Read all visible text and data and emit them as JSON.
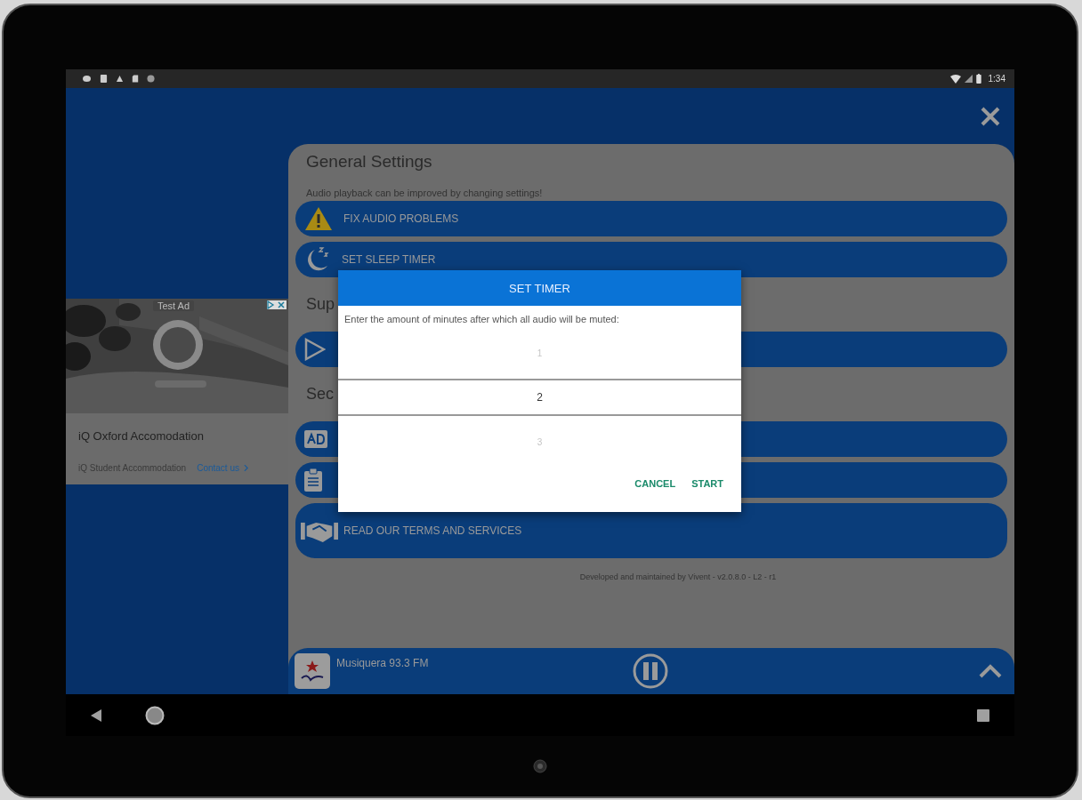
{
  "status_bar": {
    "time": "1:34"
  },
  "ad": {
    "badge": "Test Ad",
    "title": "iQ Oxford Accomodation",
    "advertiser": "iQ Student Accommodation",
    "link": "Contact us"
  },
  "settings": {
    "title": "General Settings",
    "subtitle": "Audio playback can be improved by changing settings!",
    "items": [
      {
        "kind": "button",
        "label": "FIX AUDIO PROBLEMS"
      },
      {
        "kind": "button",
        "label": "SET SLEEP TIMER"
      },
      {
        "kind": "heading",
        "label": "Sup"
      },
      {
        "kind": "button"
      },
      {
        "kind": "heading",
        "label": "Sec"
      },
      {
        "kind": "button"
      },
      {
        "kind": "button"
      },
      {
        "kind": "tall-button",
        "label": "READ OUR TERMS AND SERVICES"
      }
    ],
    "footer": "Developed and maintained by Vivent - v2.0.8.0 - L2 - r1"
  },
  "player": {
    "station": "Musiquera 93.3 FM",
    "playing": true
  },
  "dialog": {
    "title": "SET TIMER",
    "message": "Enter the amount of minutes after which all audio will be muted:",
    "picker": [
      {
        "value": "1",
        "selected": false
      },
      {
        "value": "2",
        "selected": true
      },
      {
        "value": "3",
        "selected": false
      }
    ],
    "buttons": [
      "CANCEL",
      "START"
    ]
  }
}
